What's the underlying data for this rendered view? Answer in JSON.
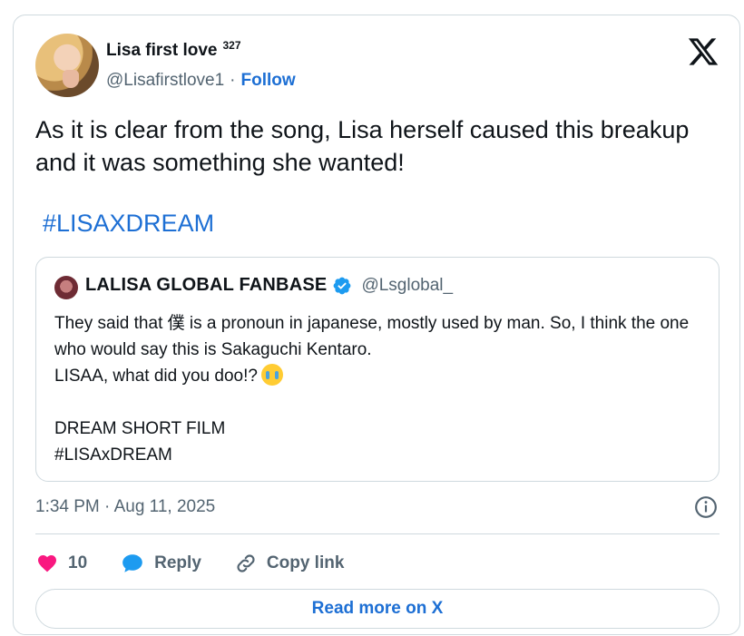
{
  "author": {
    "display_name": "Lisa first love",
    "badge_number": "327",
    "handle": "@Lisafirstlove1",
    "separator": "·",
    "follow_label": "Follow"
  },
  "tweet": {
    "text": "As it is clear from the song, Lisa herself caused this breakup and it was something she wanted!",
    "hashtag": "#LISAXDREAM"
  },
  "quoted_tweet": {
    "name": "LALISA GLOBAL FANBASE",
    "handle": "@Lsglobal_",
    "lines": [
      "They said that 僕 is a pronoun in japanese, mostly used by man. So, I think the one who would say this is Sakaguchi Kentaro.",
      "LISAA, what did you doo!?",
      "",
      "DREAM SHORT FILM",
      "#LISAxDREAM"
    ],
    "emoji_icon": "loudly-crying-face-emoji"
  },
  "timestamp": "1:34 PM · Aug 11, 2025",
  "actions": {
    "like_count": "10",
    "reply_label": "Reply",
    "copy_link_label": "Copy link"
  },
  "read_more_label": "Read more on X",
  "icons": {
    "logo": "x-logo-icon",
    "verified": "verified-badge-icon",
    "info": "info-icon",
    "heart": "heart-icon",
    "reply": "reply-bubble-icon",
    "link": "link-icon"
  },
  "colors": {
    "link_blue": "#1d6fd4",
    "heart": "#f91880",
    "verified": "#1d9bf0",
    "secondary_text": "#536471",
    "border": "#cfd9de"
  }
}
